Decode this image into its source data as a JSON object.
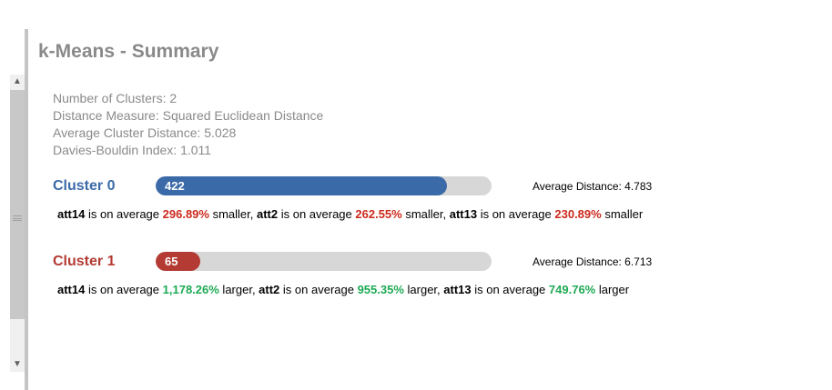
{
  "summary": {
    "title": "k-Means - Summary",
    "info": [
      "Number of Clusters: 2",
      "Distance Measure: Squared Euclidean Distance",
      "Average Cluster Distance: 5.028",
      "Davies-Bouldin Index: 1.011"
    ]
  },
  "colors": {
    "cluster0": "#3b6aa8",
    "cluster1": "#b33b33",
    "smaller_pct": "#cc2a1e",
    "larger_pct": "#1faa55",
    "info_text": "#8a8a8a"
  },
  "scrollbar": {
    "up_icon": "chevron-up-icon",
    "down_icon": "chevron-down-icon"
  },
  "clusters": [
    {
      "name": "Cluster 0",
      "count": "422",
      "fill_fraction": 0.866,
      "avg_distance": "Average Distance: 4.783",
      "pct_color": "#cc2a1e",
      "parts": [
        {
          "att": "att14",
          "pre": " is on average ",
          "pct": "296.89%",
          "post": " smaller, "
        },
        {
          "att": "att2",
          "pre": " is on average ",
          "pct": "262.55%",
          "post": " smaller, "
        },
        {
          "att": "att13",
          "pre": " is on average ",
          "pct": "230.89%",
          "post": " smaller"
        }
      ]
    },
    {
      "name": "Cluster 1",
      "count": "65",
      "fill_fraction": 0.133,
      "avg_distance": "Average Distance: 6.713",
      "pct_color": "#1faa55",
      "parts": [
        {
          "att": "att14",
          "pre": " is on average ",
          "pct": "1,178.26%",
          "post": " larger, "
        },
        {
          "att": "att2",
          "pre": " is on average ",
          "pct": "955.35%",
          "post": " larger, "
        },
        {
          "att": "att13",
          "pre": " is on average ",
          "pct": "749.76%",
          "post": " larger"
        }
      ]
    }
  ]
}
